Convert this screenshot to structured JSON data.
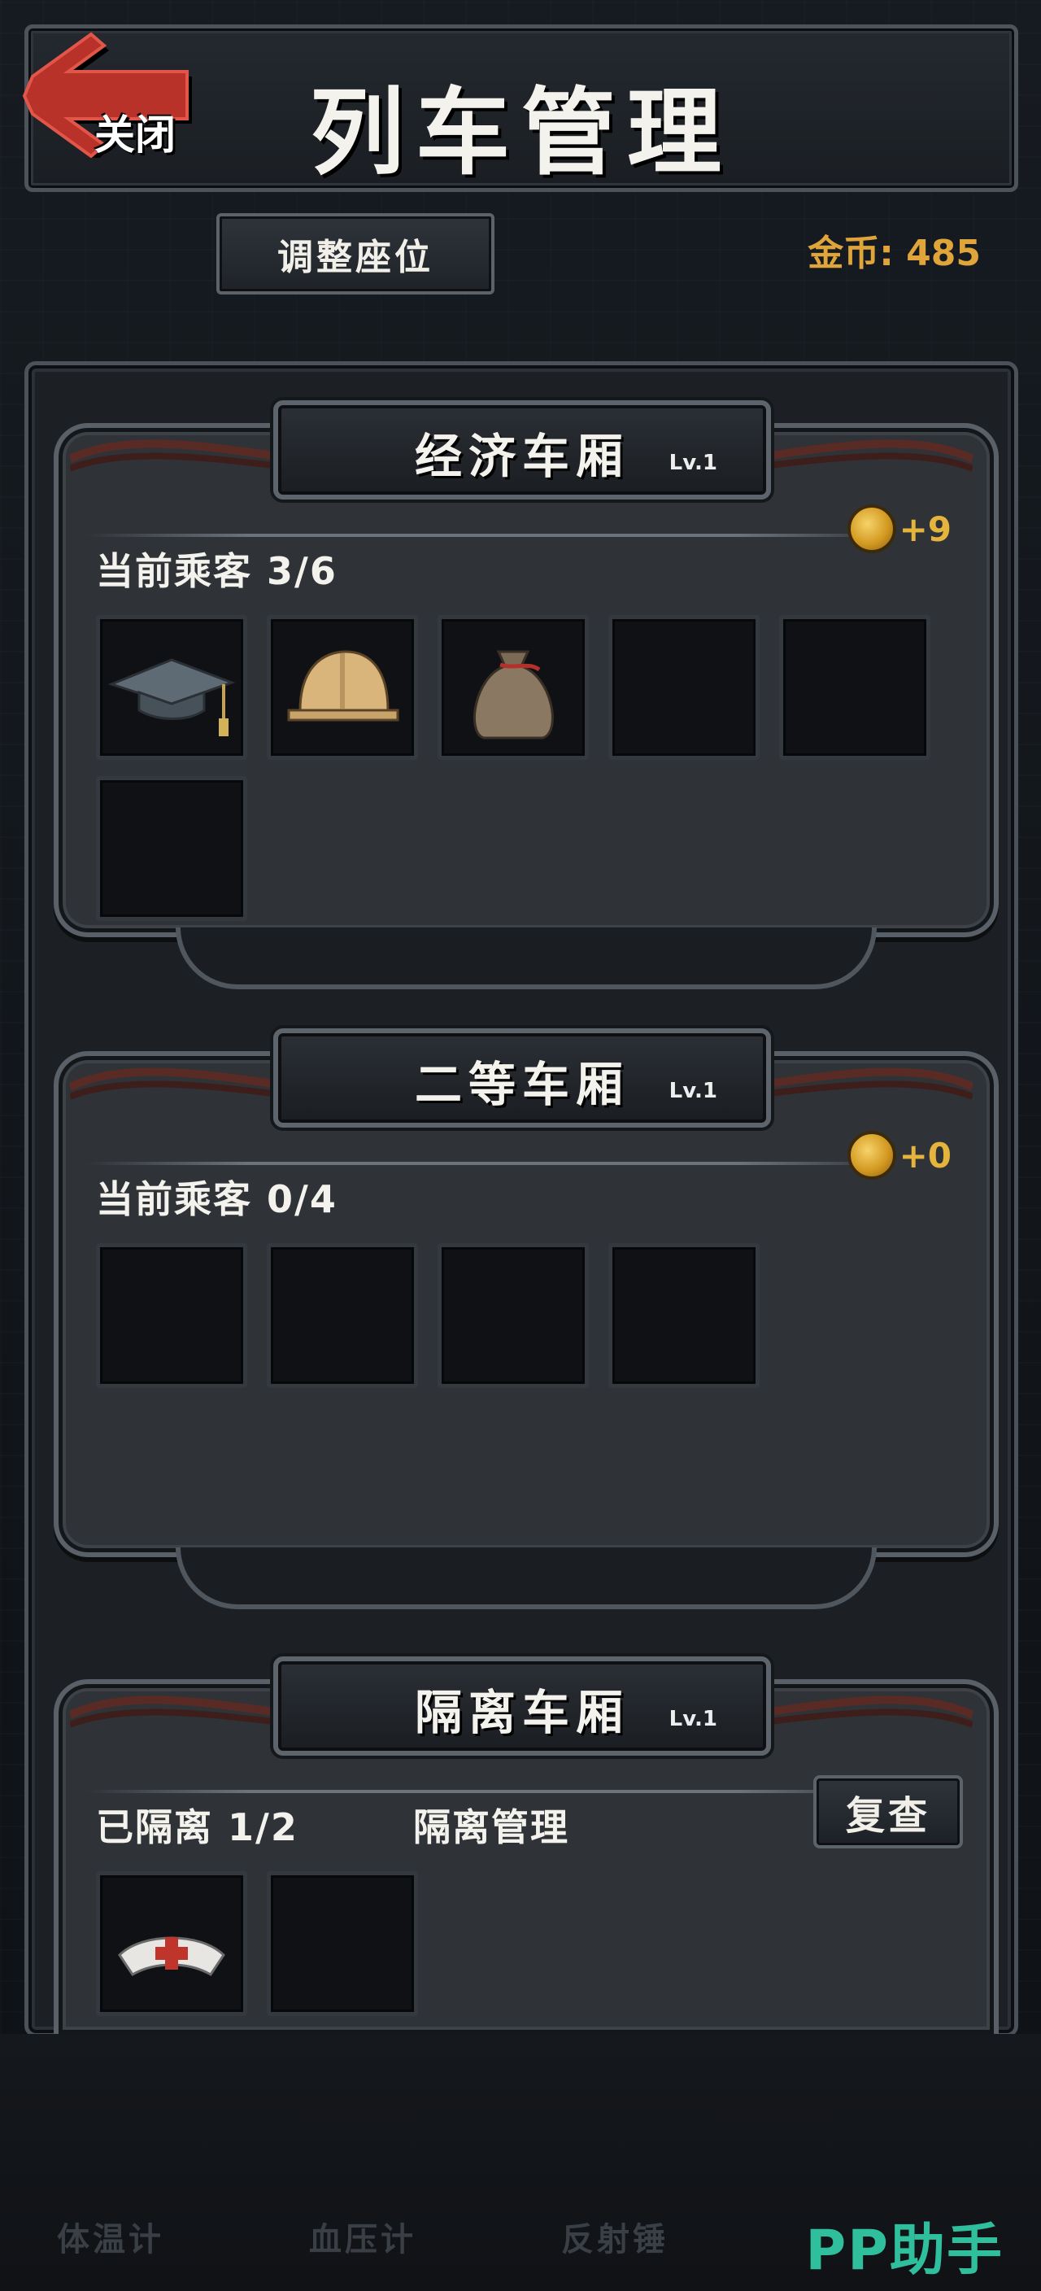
{
  "header": {
    "title": "列车管理",
    "close_label": "关闭"
  },
  "toolbar": {
    "adjust_seats_label": "调整座位",
    "coins_label": "金币: 485"
  },
  "cars": [
    {
      "name": "经济车厢",
      "level": "Lv.1",
      "income": "+9",
      "status": "当前乘客 3/6",
      "slots": [
        "graduation-cap-icon",
        "hard-hat-icon",
        "money-sack-icon",
        "",
        "",
        ""
      ]
    },
    {
      "name": "二等车厢",
      "level": "Lv.1",
      "income": "+0",
      "status": "当前乘客 0/4",
      "slots": [
        "",
        "",
        "",
        ""
      ]
    },
    {
      "name": "隔离车厢",
      "level": "Lv.1",
      "status": "已隔离 1/2",
      "manage_label": "隔离管理",
      "recheck_label": "复查",
      "slots": [
        "nurse-cap-icon",
        ""
      ]
    }
  ],
  "bottom_tabs": [
    "体温计",
    "血压计",
    "反射锤"
  ],
  "watermark": "PP助手",
  "colors": {
    "coin_gold": "#e0a53a",
    "accent_red": "#b8322a",
    "watermark_teal": "#2fbf9d"
  }
}
